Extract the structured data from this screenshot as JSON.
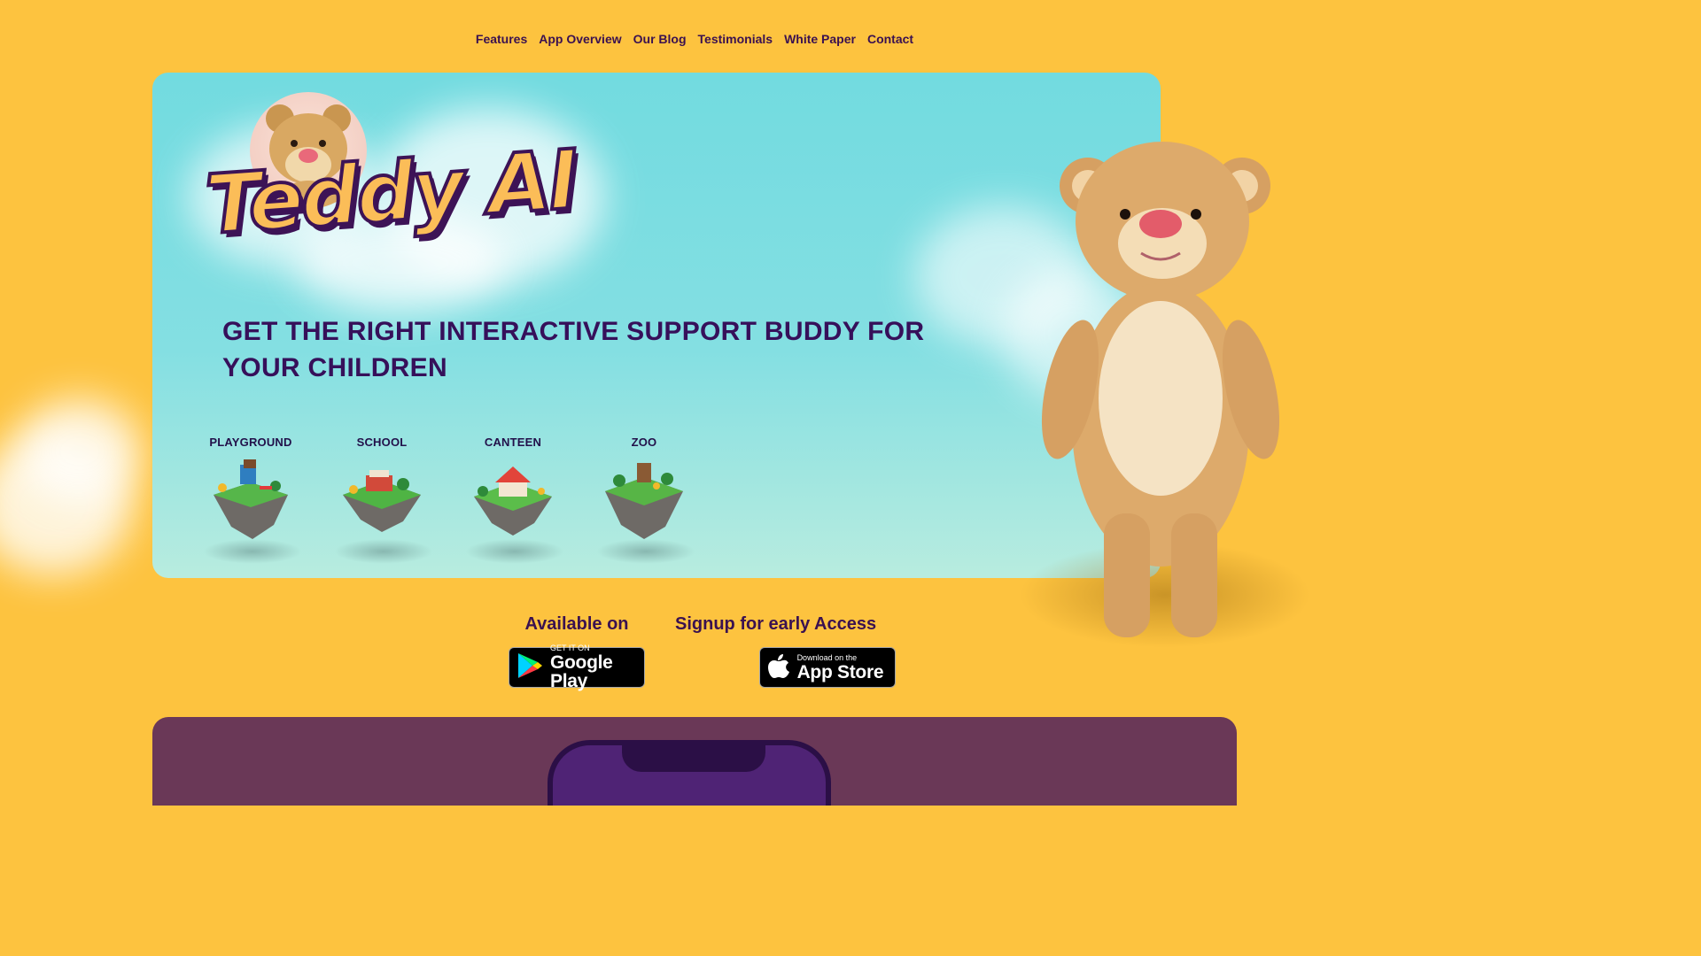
{
  "nav": {
    "items": [
      "Features",
      "App Overview",
      "Our Blog",
      "Testimonials",
      "White Paper",
      "Contact"
    ]
  },
  "hero": {
    "logo_text": "Teddy AI",
    "headline": "GET THE RIGHT INTERACTIVE SUPPORT BUDDY FOR YOUR CHILDREN",
    "places": [
      "PLAYGROUND",
      "SCHOOL",
      "CANTEEN",
      "ZOO"
    ]
  },
  "availability": {
    "available_title": "Available on",
    "signup_title": "Signup for early Access",
    "google_small": "GET IT ON",
    "google_big": "Google Play",
    "apple_small": "Download on the",
    "apple_big": "App Store"
  },
  "colors": {
    "background": "#fdc33f",
    "accent_text": "#36105a",
    "hero_sky": "#72dbe0",
    "panel": "#6a3857"
  }
}
